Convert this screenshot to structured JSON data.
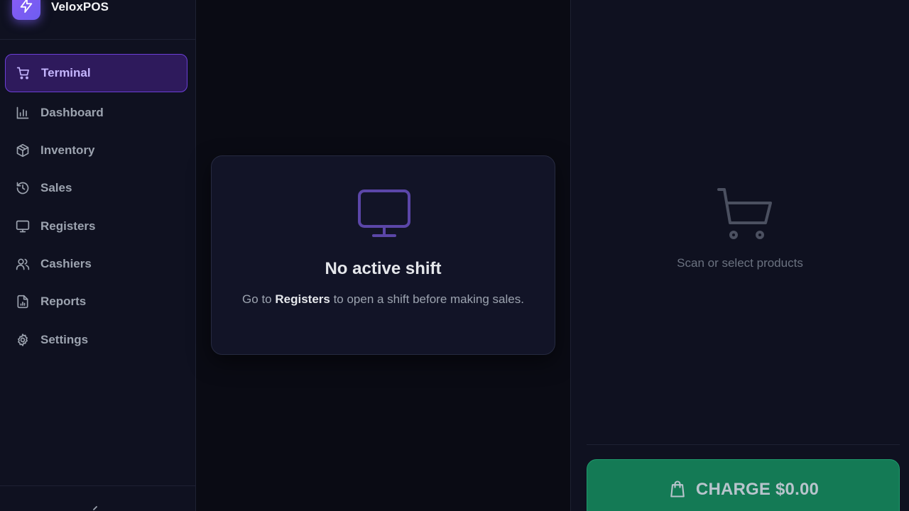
{
  "brand": {
    "name": "VeloxPOS"
  },
  "sidebar": {
    "items": [
      {
        "label": "Terminal",
        "icon": "cart-icon",
        "active": true
      },
      {
        "label": "Dashboard",
        "icon": "bar-chart-icon"
      },
      {
        "label": "Inventory",
        "icon": "package-icon"
      },
      {
        "label": "Sales",
        "icon": "history-icon"
      },
      {
        "label": "Registers",
        "icon": "monitor-icon"
      },
      {
        "label": "Cashiers",
        "icon": "users-icon"
      },
      {
        "label": "Reports",
        "icon": "file-chart-icon"
      },
      {
        "label": "Settings",
        "icon": "gear-icon"
      }
    ]
  },
  "shift": {
    "title": "No active shift",
    "desc_before": "Go to ",
    "desc_strong": "Registers",
    "desc_after": " to open a shift before making sales."
  },
  "cart": {
    "empty_text": "Scan or select products",
    "charge_label": "CHARGE $0.00"
  },
  "colors": {
    "accent": "#8b5cf6",
    "active_bg": "#2e1a5c",
    "charge_bg": "#147a55"
  }
}
